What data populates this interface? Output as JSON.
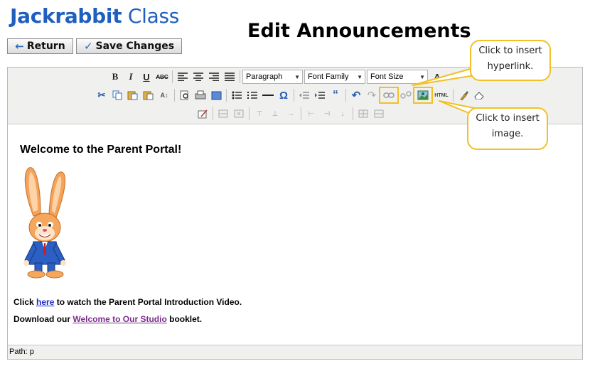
{
  "header": {
    "logo_bold": "Jackrabbit",
    "logo_light": "Class",
    "page_title": "Edit Announcements",
    "return_label": "Return",
    "save_label": "Save Changes"
  },
  "toolbar": {
    "format_select": "Paragraph",
    "font_family_select": "Font Family",
    "font_size_select": "Font Size",
    "row1_icons": [
      "bold-icon",
      "italic-icon",
      "underline-icon",
      "strikethrough-icon",
      "align-left-icon",
      "align-center-icon",
      "align-right-icon",
      "align-justify-icon"
    ],
    "row1_glyphs": [
      "B",
      "I",
      "U",
      "ABC"
    ]
  },
  "content": {
    "welcome": "Welcome to the Parent Portal!",
    "line1_prefix": "Click ",
    "line1_link": "here",
    "line1_suffix": " to watch the Parent Portal Introduction Video.",
    "line2_prefix": "Download our ",
    "line2_link": "Welcome to Our Studio",
    "line2_suffix": " booklet."
  },
  "status": {
    "path": "Path: p"
  },
  "callouts": {
    "hyperlink": "Click to insert hyperlink.",
    "image": "Click to insert image."
  },
  "colors": {
    "brand": "#1f5fbf",
    "highlight": "#f2c024",
    "link": "#1a28c8",
    "visited_link": "#7c2b8c"
  }
}
